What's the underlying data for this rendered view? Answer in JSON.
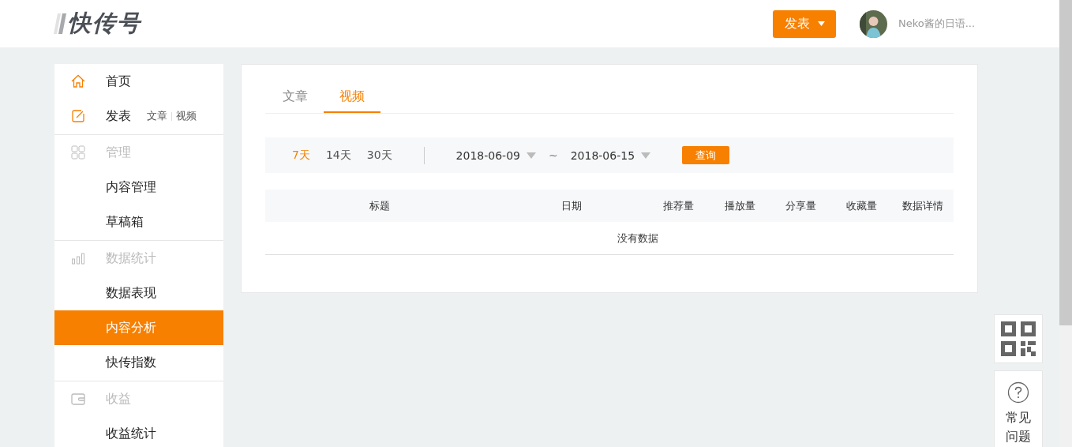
{
  "header": {
    "logo": "快传号",
    "publish_button": "发表",
    "user_name": "Neko酱的日语..."
  },
  "sidebar": {
    "groups": [
      {
        "items": [
          {
            "kind": "home",
            "label": "首页",
            "selected": false
          },
          {
            "kind": "publish",
            "label": "发表",
            "selected": false,
            "links": [
              "文章",
              "视频"
            ]
          }
        ]
      },
      {
        "items": [
          {
            "kind": "grid",
            "label": "管理",
            "selected": false
          },
          {
            "kind": "sub",
            "label": "内容管理",
            "selected": false
          },
          {
            "kind": "sub",
            "label": "草稿箱",
            "selected": false
          }
        ]
      },
      {
        "items": [
          {
            "kind": "bars",
            "label": "数据统计",
            "selected": false
          },
          {
            "kind": "sub",
            "label": "数据表现",
            "selected": false
          },
          {
            "kind": "sub",
            "label": "内容分析",
            "selected": true
          },
          {
            "kind": "sub",
            "label": "快传指数",
            "selected": false
          }
        ]
      },
      {
        "items": [
          {
            "kind": "wallet",
            "label": "收益",
            "selected": false
          },
          {
            "kind": "sub",
            "label": "收益统计",
            "selected": false
          }
        ]
      }
    ]
  },
  "main": {
    "tabs": [
      {
        "label": "文章",
        "selected": false
      },
      {
        "label": "视频",
        "selected": true
      }
    ],
    "ranges": [
      {
        "label": "7天",
        "selected": true
      },
      {
        "label": "14天",
        "selected": false
      },
      {
        "label": "30天",
        "selected": false
      }
    ],
    "date_from": "2018-06-09",
    "date_separator": "~",
    "date_to": "2018-06-15",
    "query_button": "查询",
    "table": {
      "columns": [
        "标题",
        "日期",
        "推荐量",
        "播放量",
        "分享量",
        "收藏量",
        "数据详情"
      ],
      "empty_text": "没有数据"
    }
  },
  "float": {
    "faq": "常见问题"
  }
}
